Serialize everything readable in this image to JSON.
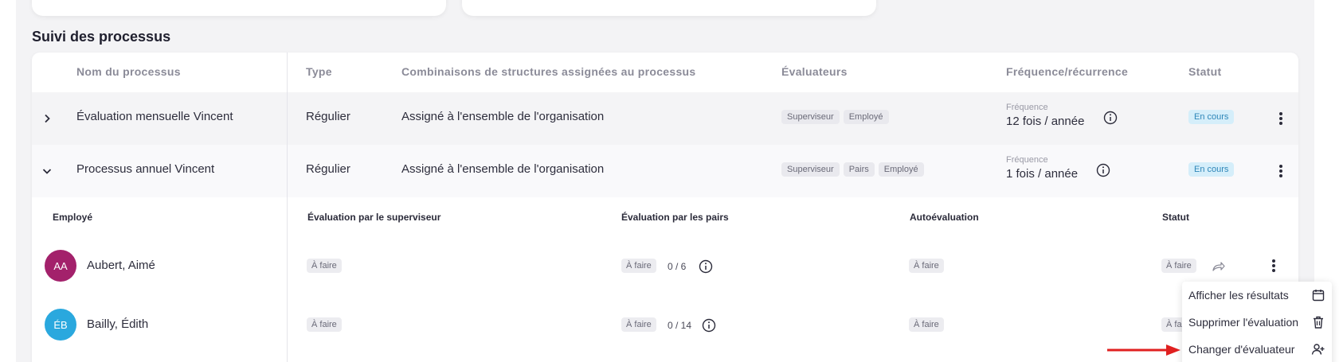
{
  "section": {
    "title": "Suivi des processus"
  },
  "table": {
    "headers": {
      "name": "Nom du processus",
      "type": "Type",
      "structures": "Combinaisons de structures assignées au processus",
      "evaluators": "Évaluateurs",
      "frequency": "Fréquence/récurrence",
      "status": "Statut"
    },
    "rows": [
      {
        "name": "Évaluation mensuelle Vincent",
        "type": "Régulier",
        "structures": "Assigné à l'ensemble de l'organisation",
        "evaluators": [
          "Superviseur",
          "Employé"
        ],
        "frequency_label": "Fréquence",
        "frequency_value": "12 fois / année",
        "status": "En cours",
        "expanded": false
      },
      {
        "name": "Processus annuel Vincent",
        "type": "Régulier",
        "structures": "Assigné à l'ensemble de l'organisation",
        "evaluators": [
          "Superviseur",
          "Pairs",
          "Employé"
        ],
        "frequency_label": "Fréquence",
        "frequency_value": "1 fois / année",
        "status": "En cours",
        "expanded": true
      }
    ]
  },
  "subtable": {
    "headers": {
      "employee": "Employé",
      "supervisor": "Évaluation par le superviseur",
      "peers": "Évaluation par les pairs",
      "self": "Autoévaluation",
      "status": "Statut"
    },
    "rows": [
      {
        "initials": "AA",
        "avatar_color": "#a3216b",
        "name": "Aubert, Aimé",
        "supervisor": "À faire",
        "peers": "À faire",
        "peers_count": "0 / 6",
        "self": "À faire",
        "status": "À faire"
      },
      {
        "initials": "ÉB",
        "avatar_color": "#2aa8de",
        "name": "Bailly, Édith",
        "supervisor": "À faire",
        "peers": "À faire",
        "peers_count": "0 / 14",
        "self": "À faire",
        "status": "À fa"
      }
    ]
  },
  "context_menu": {
    "items": [
      {
        "label": "Afficher les résultats",
        "icon": "calendar-icon"
      },
      {
        "label": "Supprimer l'évaluation",
        "icon": "trash-icon"
      },
      {
        "label": "Changer d'évaluateur",
        "icon": "user-plus-icon"
      }
    ]
  },
  "colors": {
    "status_badge_bg": "#d5eefa",
    "status_badge_text": "#2e86b8",
    "arrow": "#e02020"
  }
}
